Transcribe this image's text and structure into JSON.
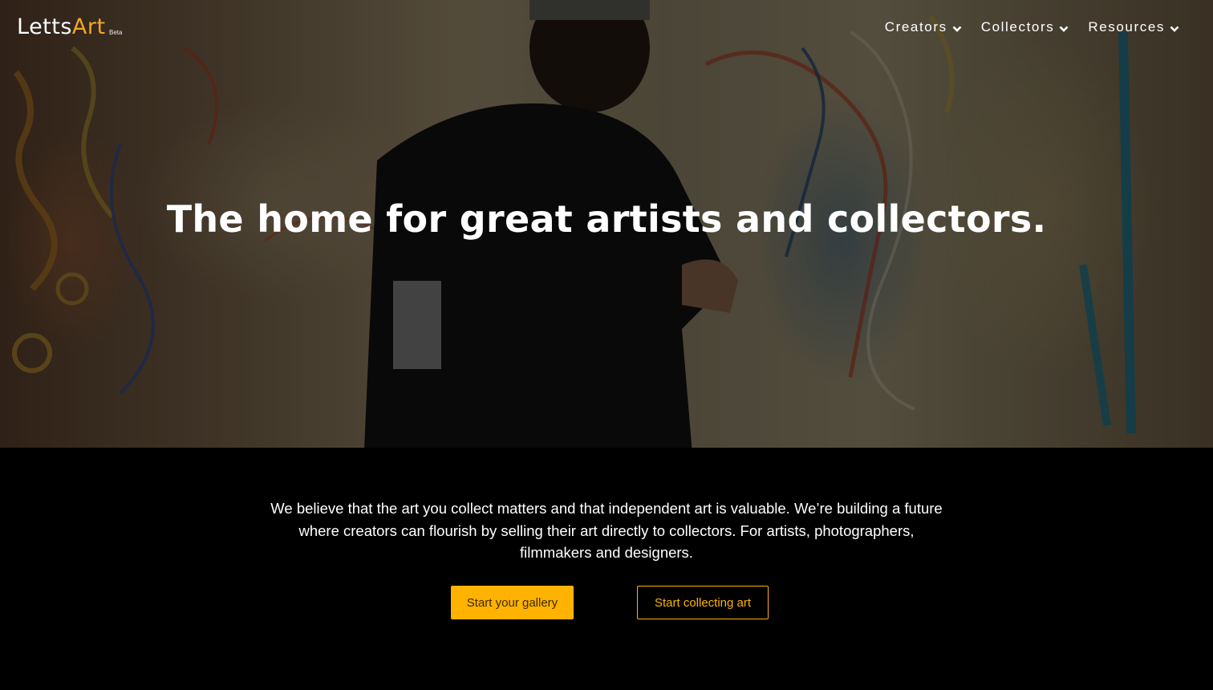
{
  "colors": {
    "accent": "#ffb300",
    "logo_accent": "#f5a623",
    "background": "#000000",
    "text": "#ffffff"
  },
  "brand": {
    "name_part1": "Letts",
    "name_part2": "Art",
    "badge": "Beta"
  },
  "nav": {
    "items": [
      {
        "label": "Creators",
        "icon": "chevron-down-icon"
      },
      {
        "label": "Collectors",
        "icon": "chevron-down-icon"
      },
      {
        "label": "Resources",
        "icon": "chevron-down-icon"
      }
    ]
  },
  "hero": {
    "headline": "The home for great artists and collectors."
  },
  "intro": {
    "text": "We believe that the art you collect matters and that independent art is valuable. We’re building a future where creators can flourish by selling their art directly to collectors. For artists, photographers, filmmakers and designers."
  },
  "cta": {
    "primary_label": "Start your gallery",
    "secondary_label": "Start collecting art"
  }
}
